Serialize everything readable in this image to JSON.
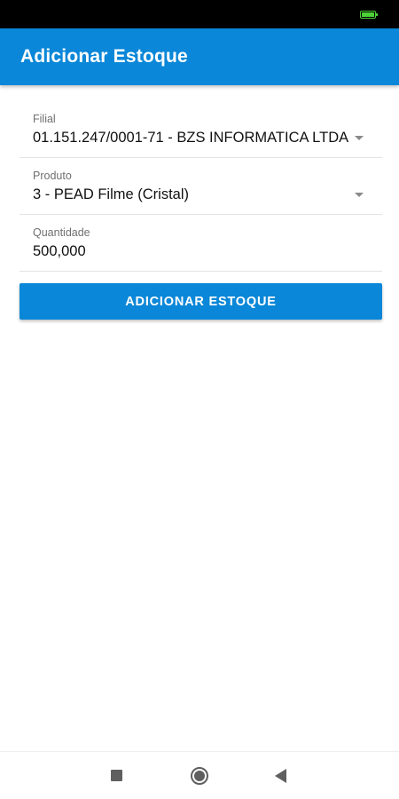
{
  "status_bar": {
    "battery_icon": "battery-icon",
    "battery_color": "#4cd137"
  },
  "app_bar": {
    "title": "Adicionar Estoque",
    "color": "#0a87d8"
  },
  "form": {
    "filial": {
      "label": "Filial",
      "value": "01.151.247/0001-71 - BZS INFORMATICA LTDA",
      "icon": "dropdown-arrow-icon"
    },
    "produto": {
      "label": "Produto",
      "value": "3 - PEAD Filme (Cristal)",
      "icon": "dropdown-arrow-icon"
    },
    "quantidade": {
      "label": "Quantidade",
      "value": "500,000"
    },
    "submit_label": "ADICIONAR ESTOQUE"
  },
  "nav_bar": {
    "recents_icon": "recents-square-icon",
    "home_icon": "home-circle-icon",
    "back_icon": "back-triangle-icon"
  }
}
